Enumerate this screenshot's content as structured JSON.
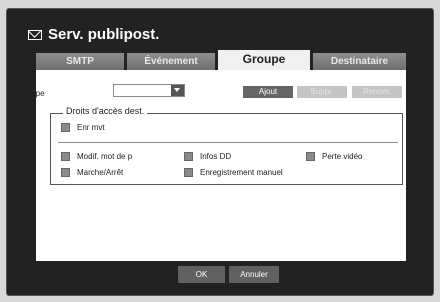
{
  "window": {
    "title": "Serv. publipost."
  },
  "tabs": [
    {
      "label": "SMTP"
    },
    {
      "label": "Événement"
    },
    {
      "label": "Groupe"
    },
    {
      "label": "Destinataire"
    }
  ],
  "group": {
    "label": "· Groupe",
    "selected": "",
    "add_label": "Ajout",
    "delete_label": "Suppr.",
    "rename_label": "Renom."
  },
  "rights": {
    "legend": "Droits d'accès dest.",
    "enr_mvt": "Enr mvt",
    "items": [
      {
        "label": "Modif. mot de p"
      },
      {
        "label": "Infos DD"
      },
      {
        "label": "Perte vidéo"
      },
      {
        "label": "Marche/Arrêt"
      },
      {
        "label": "Enregistrement manuel"
      }
    ]
  },
  "footer": {
    "ok_label": "OK",
    "cancel_label": "Annuler"
  }
}
